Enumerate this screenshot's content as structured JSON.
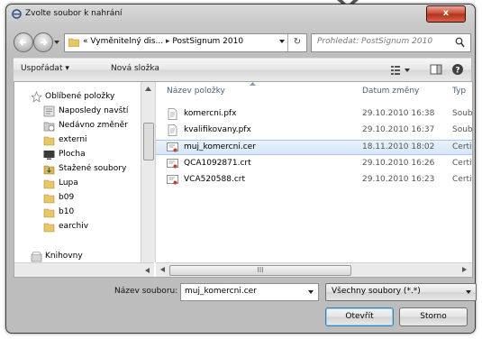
{
  "window": {
    "title": "Zvolte soubor k nahrání",
    "close_label": "x"
  },
  "address": {
    "path_prefix": "«",
    "segment1": "Vyměnitelný dis...",
    "separator": "▸",
    "segment2": "PostSignum 2010",
    "refresh_label": "↻"
  },
  "search": {
    "placeholder": "Prohledat: PostSignum 2010"
  },
  "toolbar": {
    "organize_label": "Uspořádat ▾",
    "new_folder_label": "Nová složka"
  },
  "nav_pane": {
    "items": [
      {
        "label": "Oblíbené položky",
        "icon": "star-icon"
      },
      {
        "label": "Naposledy navští",
        "icon": "recent-places-icon"
      },
      {
        "label": "Nedávno změněr",
        "icon": "recently-changed-icon"
      },
      {
        "label": "externi",
        "icon": "folder-icon"
      },
      {
        "label": "Plocha",
        "icon": "desktop-icon"
      },
      {
        "label": "Stažené soubory",
        "icon": "downloads-icon"
      },
      {
        "label": "Lupa",
        "icon": "folder-icon"
      },
      {
        "label": "b09",
        "icon": "folder-icon"
      },
      {
        "label": "b10",
        "icon": "folder-icon"
      },
      {
        "label": "earchiv",
        "icon": "folder-icon"
      },
      {
        "label": "Knihovny",
        "icon": "libraries-icon"
      }
    ]
  },
  "file_list": {
    "columns": [
      "Název položky",
      "Datum změny",
      "Typ"
    ],
    "rows": [
      {
        "name": "komercni.pfx",
        "date": "29.10.2010 16:38",
        "type": "Soubor PF",
        "icon": "pfx-file-icon",
        "selected": false
      },
      {
        "name": "kvalifikovany.pfx",
        "date": "29.10.2010 16:37",
        "type": "Soubor PF",
        "icon": "pfx-file-icon",
        "selected": false
      },
      {
        "name": "muj_komercni.cer",
        "date": "18.11.2010 18:02",
        "type": "Certifikát",
        "icon": "certificate-file-icon",
        "selected": true
      },
      {
        "name": "QCA1092871.crt",
        "date": "29.10.2010 16:26",
        "type": "Certifikát",
        "icon": "certificate-file-icon",
        "selected": false
      },
      {
        "name": "VCA520588.crt",
        "date": "29.10.2010 16:23",
        "type": "Certifikát",
        "icon": "certificate-file-icon",
        "selected": false
      }
    ],
    "hscroll_grip": "III"
  },
  "footer": {
    "filename_label": "Název souboru:",
    "filename_value": "muj_komercni.cer",
    "filetype_value": "Všechny soubory (*.*)",
    "open_label": "Otevřít",
    "cancel_label": "Storno"
  },
  "colors": {
    "selection": "#d5e6f7",
    "column_header": "#4c607a",
    "close_button": "#c8432c"
  }
}
